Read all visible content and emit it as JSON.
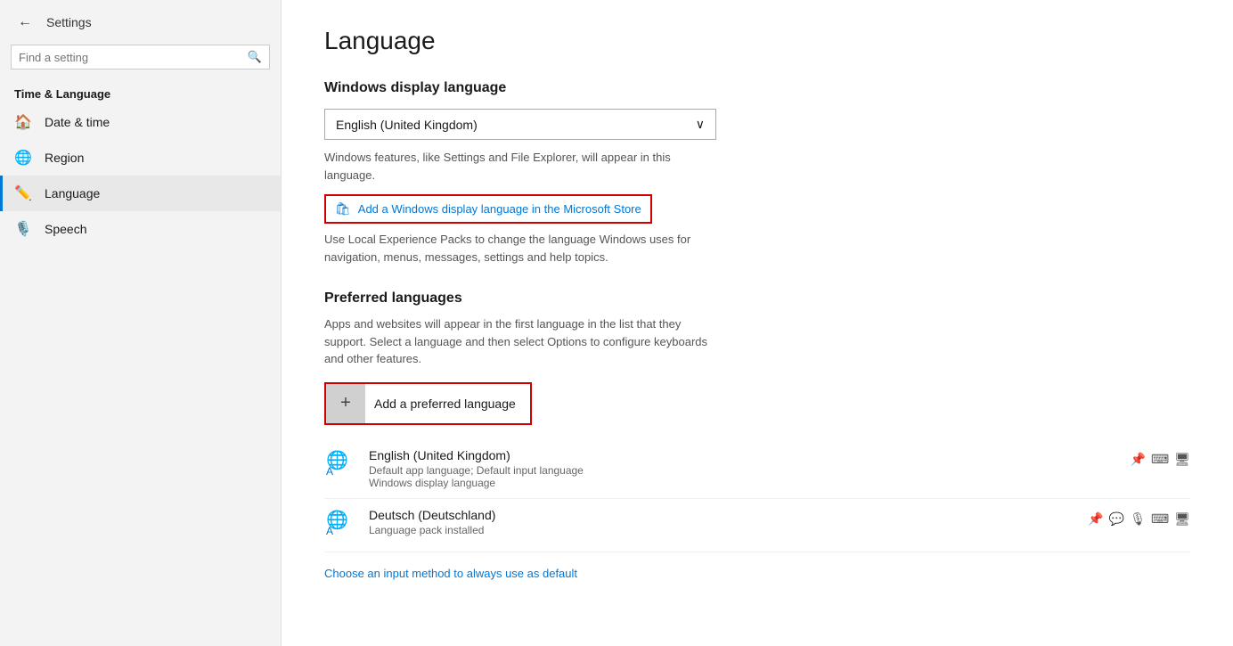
{
  "sidebar": {
    "back_label": "←",
    "title": "Settings",
    "search_placeholder": "Find a setting",
    "section_label": "Time & Language",
    "nav_items": [
      {
        "id": "date-time",
        "label": "Date & time",
        "icon": "🏠"
      },
      {
        "id": "region",
        "label": "Region",
        "icon": "🌐"
      },
      {
        "id": "language",
        "label": "Language",
        "icon": "✏️",
        "active": true
      },
      {
        "id": "speech",
        "label": "Speech",
        "icon": "🎙️"
      }
    ]
  },
  "main": {
    "page_title": "Language",
    "display_language": {
      "heading": "Windows display language",
      "selected": "English (United Kingdom)",
      "chevron": "∨",
      "desc": "Windows features, like Settings and File Explorer, will appear in this language.",
      "store_link_text": "Add a Windows display language in the Microsoft Store",
      "store_desc": "Use Local Experience Packs to change the language Windows uses for navigation, menus, messages, settings and help topics."
    },
    "preferred_languages": {
      "heading": "Preferred languages",
      "desc": "Apps and websites will appear in the first language in the list that they support. Select a language and then select Options to configure keyboards and other features.",
      "add_button_label": "Add a preferred language",
      "languages": [
        {
          "name": "English (United Kingdom)",
          "sub": "Default app language; Default input language\nWindows display language",
          "features": [
            "🏳️",
            "⌨️",
            "🖥️"
          ]
        },
        {
          "name": "Deutsch (Deutschland)",
          "sub": "Language pack installed",
          "features": [
            "🏳️",
            "💬",
            "🎙️",
            "⌨️",
            "🖥️"
          ]
        }
      ],
      "input_default_link": "Choose an input method to always use as default"
    }
  }
}
